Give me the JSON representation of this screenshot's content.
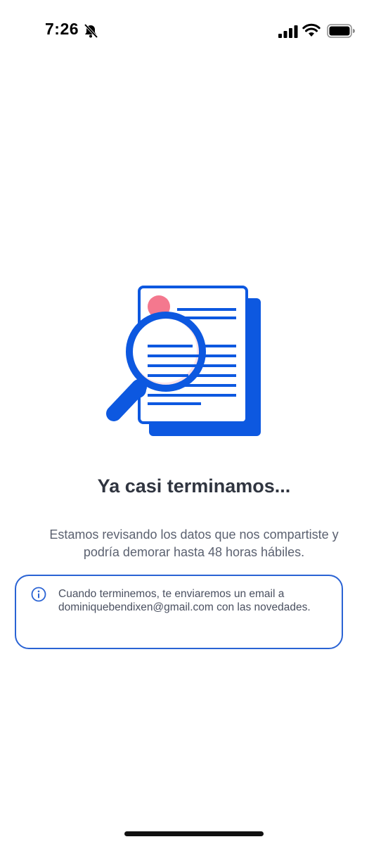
{
  "status_bar": {
    "time": "7:26",
    "icons": [
      "bell-slash-icon",
      "signal-bars-icon",
      "wifi-icon",
      "battery-icon"
    ]
  },
  "illustration": {
    "icon": "document-magnifier-illustration",
    "colors": {
      "blue": "#0d58e0",
      "pink": "#f4788e",
      "light_pink": "#fbe3ea",
      "white": "#ffffff"
    }
  },
  "content": {
    "title": "Ya casi terminamos...",
    "description_line1": "Estamos revisando los datos que nos compartiste y",
    "description_line2": "podría demorar hasta 48 horas hábiles."
  },
  "info": {
    "icon": "info-icon",
    "line1": "Cuando terminemos, te enviaremos un email a",
    "line2": "dominiquebendixen@gmail.com con las novedades.",
    "border_color": "#2a63d4"
  }
}
